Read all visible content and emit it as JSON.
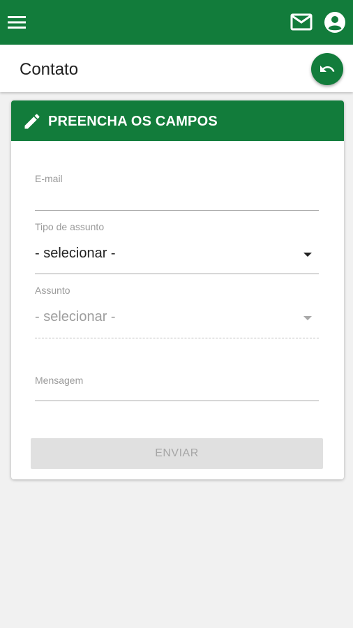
{
  "appbar": {
    "icons": [
      "menu-icon",
      "mail-icon",
      "account-circle-icon"
    ]
  },
  "header": {
    "title": "Contato",
    "back_icon": "undo-icon"
  },
  "form": {
    "card_title": "PREENCHA OS CAMPOS",
    "card_icon": "pencil-icon",
    "email": {
      "label": "E-mail",
      "value": ""
    },
    "tipo": {
      "label": "Tipo de assunto",
      "value": "- selecionar -"
    },
    "assunto": {
      "label": "Assunto",
      "value": "- selecionar -",
      "disabled": true
    },
    "mensagem": {
      "label": "Mensagem",
      "value": ""
    },
    "submit_label": "ENVIAR",
    "submit_disabled": true
  },
  "colors": {
    "primary": "#127c3b",
    "background": "#f1f1f1",
    "disabled_button": "#e0e0e0"
  }
}
